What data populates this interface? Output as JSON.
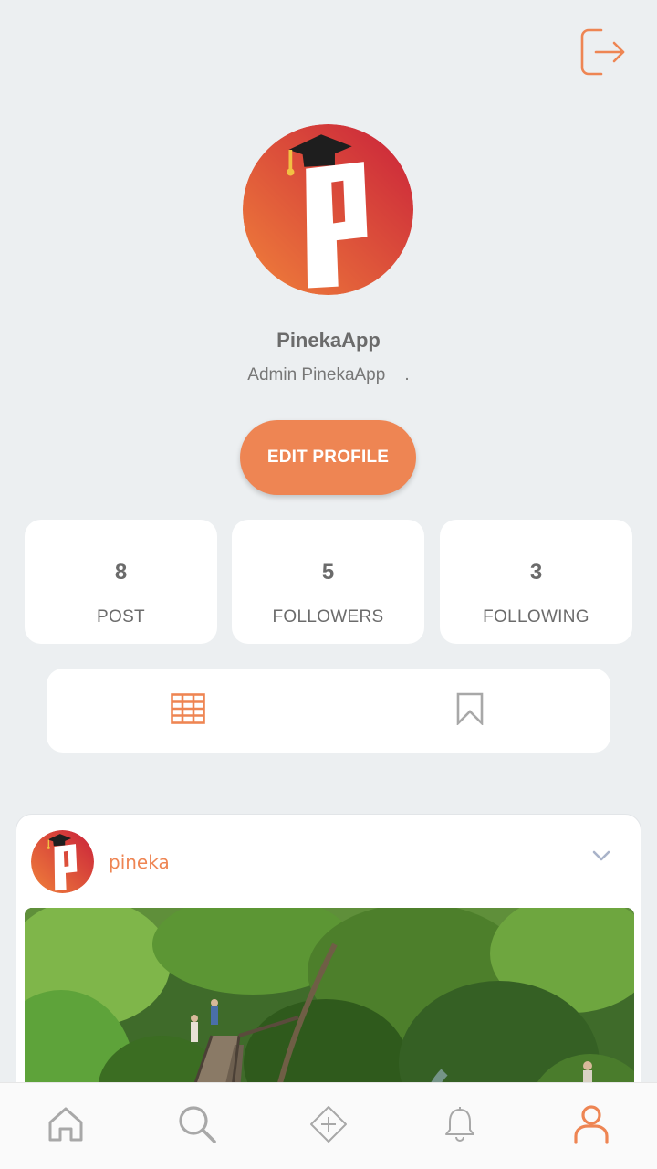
{
  "colors": {
    "accent": "#EE8553",
    "background": "#ECEFF1",
    "card": "#FFFFFF",
    "text_muted": "#6B6B6B",
    "icon_inactive": "#A8A8A8"
  },
  "header": {
    "logout_icon": "logout-icon"
  },
  "profile": {
    "avatar_icon": "pineka-logo",
    "name": "PinekaApp",
    "bio": "Admin PinekaApp    .",
    "edit_label": "EDIT PROFILE"
  },
  "stats": [
    {
      "value": "8",
      "label": "POST"
    },
    {
      "value": "5",
      "label": "FOLLOWERS"
    },
    {
      "value": "3",
      "label": "FOLLOWING"
    }
  ],
  "tabs": [
    {
      "icon": "grid-icon",
      "active": true
    },
    {
      "icon": "bookmark-icon",
      "active": false
    }
  ],
  "post": {
    "username": "pineka",
    "menu_icon": "chevron-down-icon",
    "image_subject": "forest-walkway-photo"
  },
  "bottom_nav": [
    {
      "icon": "home-icon",
      "active": false
    },
    {
      "icon": "search-icon",
      "active": false
    },
    {
      "icon": "add-post-icon",
      "active": false
    },
    {
      "icon": "bell-icon",
      "active": false
    },
    {
      "icon": "profile-icon",
      "active": true
    }
  ]
}
